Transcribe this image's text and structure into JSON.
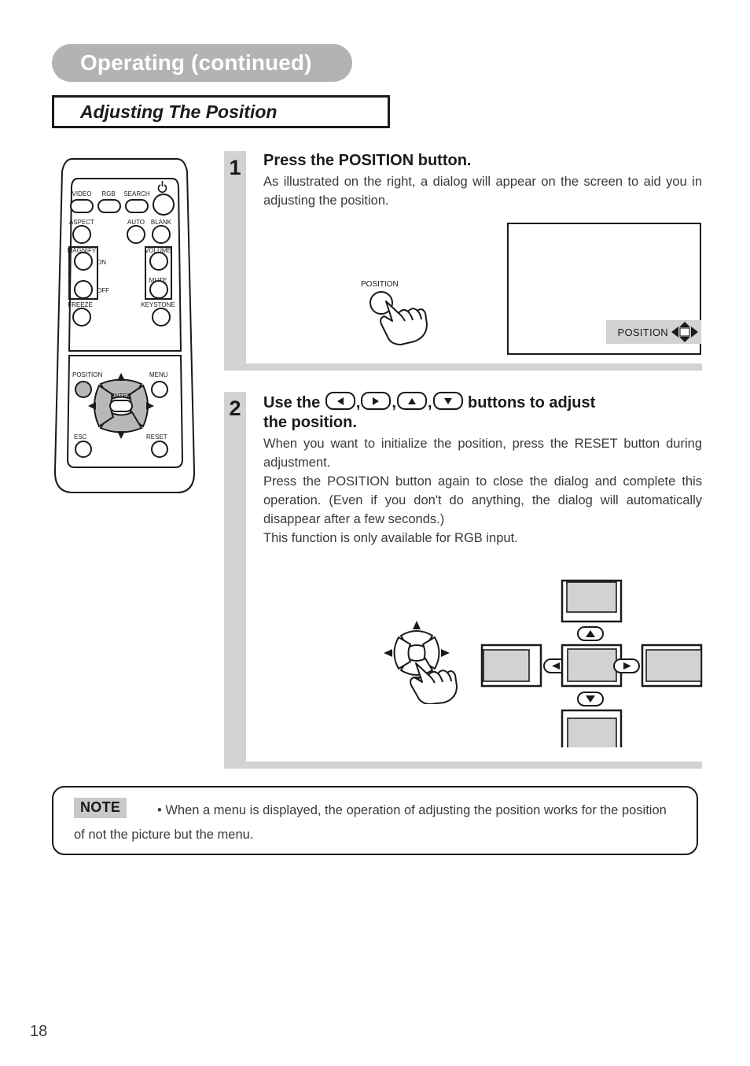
{
  "header": {
    "chapter_title": "Operating (continued)",
    "section_title": "Adjusting The Position"
  },
  "remote": {
    "name": "projector-remote-control",
    "buttons": [
      {
        "label": "VIDEO"
      },
      {
        "label": "RGB"
      },
      {
        "label": "SEARCH"
      },
      {
        "label": "power-icon"
      },
      {
        "label": "ASPECT"
      },
      {
        "label": "AUTO"
      },
      {
        "label": "BLANK"
      },
      {
        "label": "MAGNIFY"
      },
      {
        "label": "ON"
      },
      {
        "label": "OFF"
      },
      {
        "label": "VOLUME"
      },
      {
        "label": "MUTE"
      },
      {
        "label": "FREEZE"
      },
      {
        "label": "KEYSTONE"
      },
      {
        "label": "POSITION"
      },
      {
        "label": "MENU"
      },
      {
        "label": "ENTER"
      },
      {
        "label": "ESC"
      },
      {
        "label": "RESET"
      }
    ],
    "labels": {
      "video": "VIDEO",
      "rgb": "RGB",
      "search": "SEARCH",
      "aspect": "ASPECT",
      "auto": "AUTO",
      "blank": "BLANK",
      "magnify": "MAGNIFY",
      "on": "ON",
      "off": "OFF",
      "volume": "VOLUME",
      "mute": "MUTE",
      "freeze": "FREEZE",
      "keystone": "KEYSTONE",
      "position": "POSITION",
      "menu": "MENU",
      "enter": "ENTER",
      "esc": "ESC",
      "reset": "RESET"
    }
  },
  "steps": [
    {
      "number": "1",
      "title": "Press the POSITION button.",
      "body": "As illustrated on the right, a dialog will appear on the screen to aid you in adjusting the position.",
      "illustration": {
        "button_label": "POSITION",
        "osd_label": "POSITION"
      }
    },
    {
      "number": "2",
      "title_prefix": "Use the ",
      "title_suffix": " buttons to adjust",
      "title_line2": "the position.",
      "body_paragraphs": [
        "When you want to initialize the position, press the RESET button during adjustment.",
        "Press the POSITION button again to close the dialog and complete this operation.  (Even if you don't do anything, the dialog will automatically disappear after a few seconds.)",
        "This function is only available for RGB input."
      ],
      "keys": [
        "left-arrow",
        "right-arrow",
        "up-arrow",
        "down-arrow"
      ]
    }
  ],
  "note": {
    "tag": "NOTE",
    "text": "• When a menu is displayed, the operation of adjusting the position works for the position of not the picture but the menu."
  },
  "page_number": "18",
  "colors": {
    "chapter_pill": "#b3b3b3",
    "step_column": "#d2d2d2",
    "osd_background": "#d2d2d2",
    "ink": "#1a1a1a",
    "body_text": "#3a3a3a"
  }
}
